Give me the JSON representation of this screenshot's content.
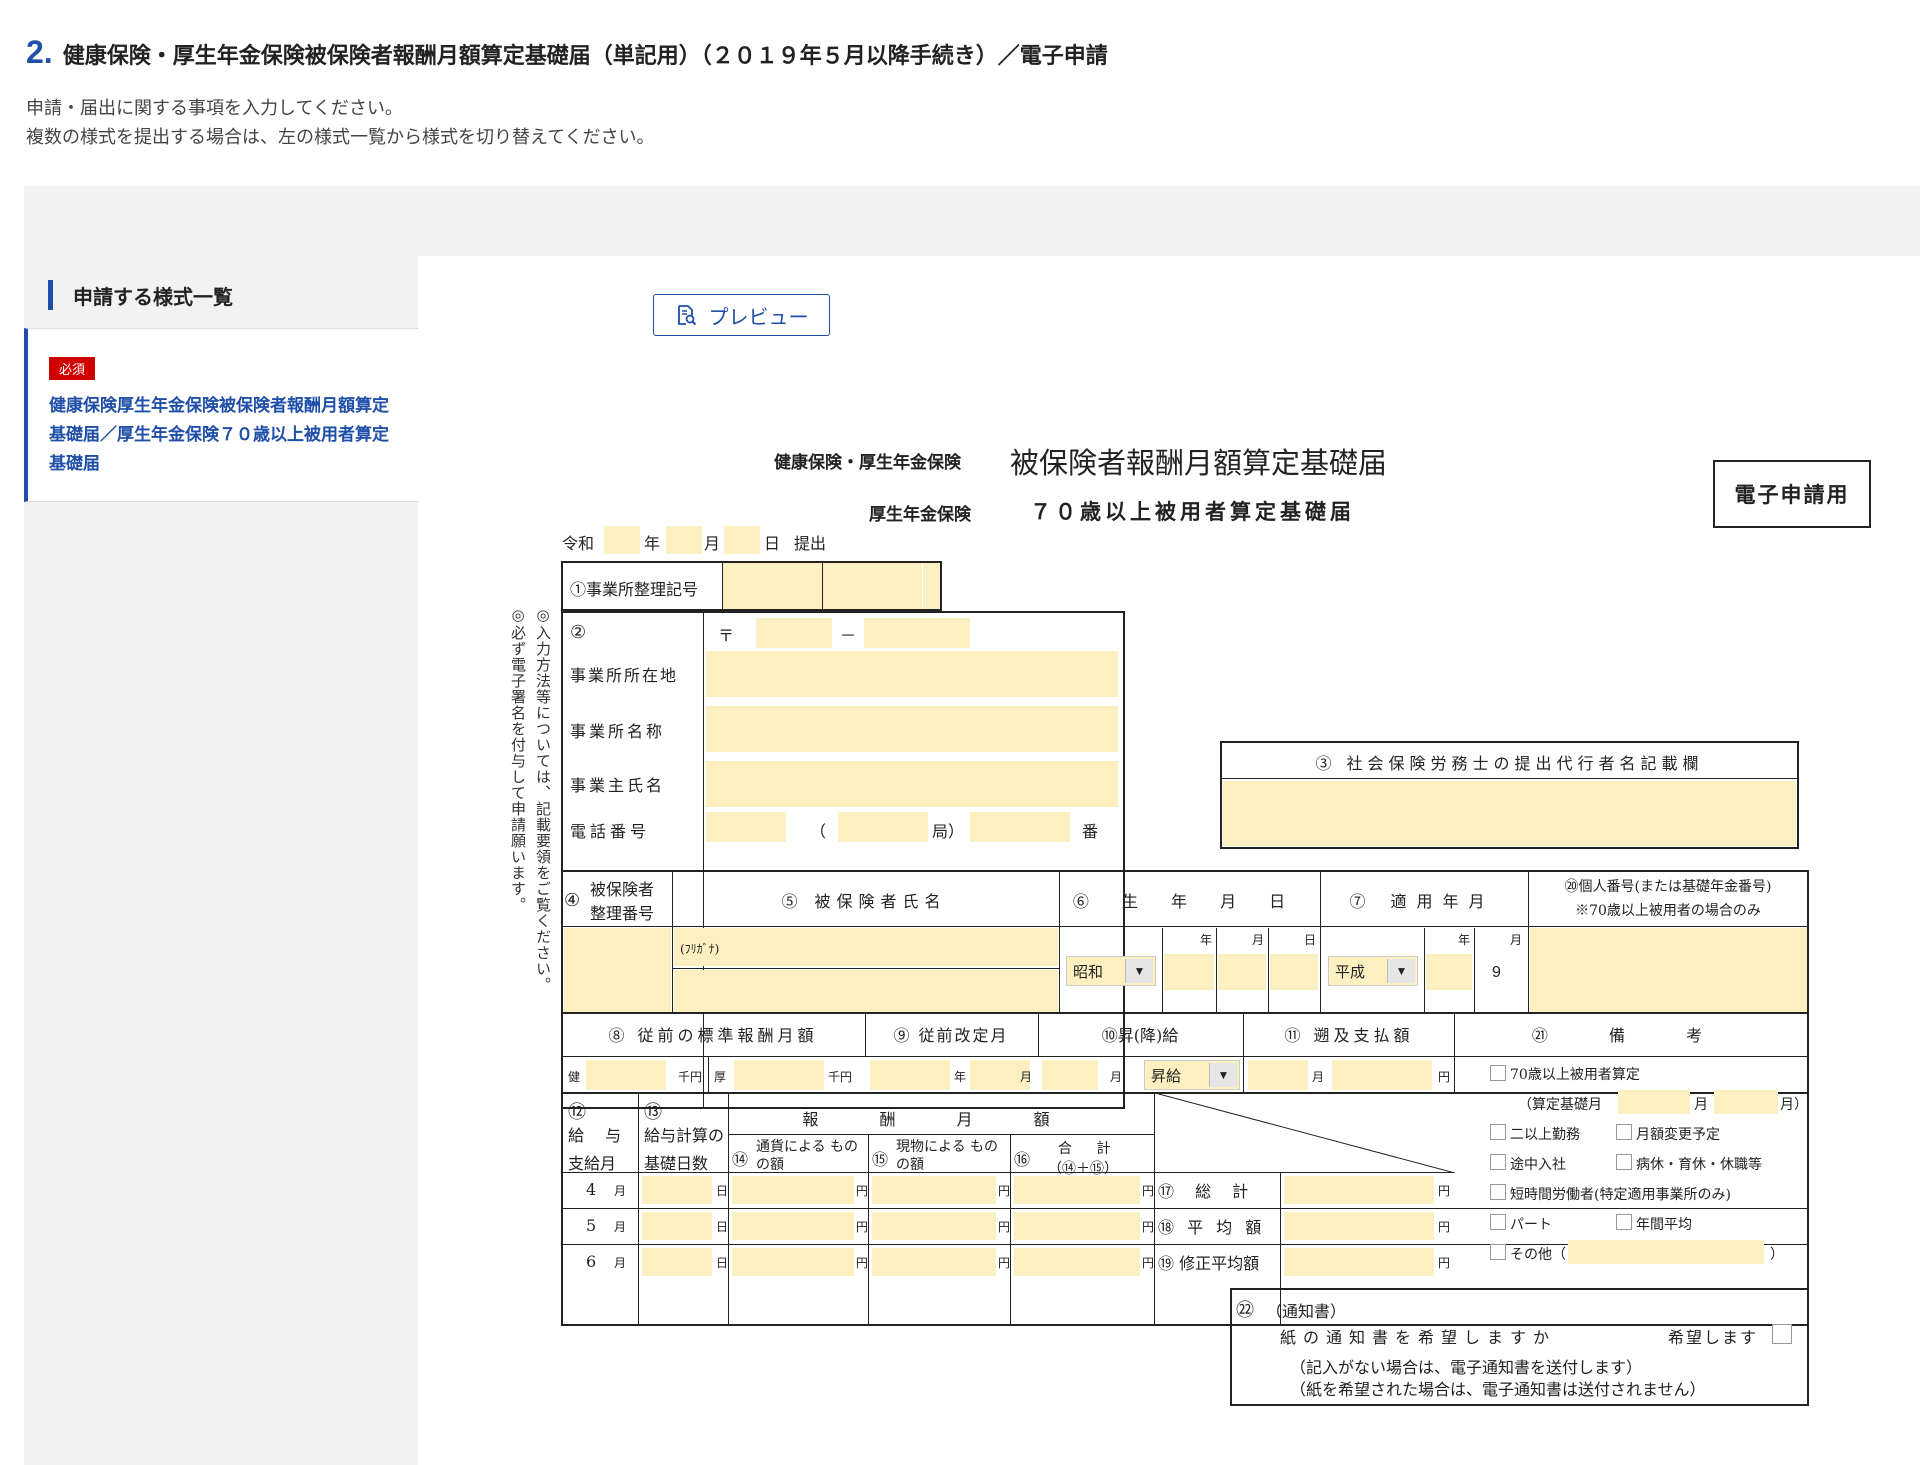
{
  "header": {
    "step_number": "2.",
    "title": "健康保険・厚生年金保険被保険者報酬月額算定基礎届（単記用）（２０１９年５月以降手続き）／電子申請",
    "intro_line1": "申請・届出に関する事項を入力してください。",
    "intro_line2": "複数の様式を提出する場合は、左の様式一覧から様式を切り替えてください。"
  },
  "sidebar": {
    "heading": "申請する様式一覧",
    "items": [
      {
        "badge": "必須",
        "label": "健康保険厚生年金保険被保険者報酬月額算定基礎届／厚生年金保険７０歳以上被用者算定基礎届"
      }
    ]
  },
  "toolbar": {
    "preview_label": "プレビュー"
  },
  "form": {
    "side_note1": "◎入力方法等については、記載要領をご覧ください。",
    "side_note2": "◎必ず電子署名を付与して申請願います。",
    "title_prefix": "健康保険・厚生年金保険",
    "title_main": "被保険者報酬月額算定基礎届",
    "subtitle_prefix": "厚生年金保険",
    "subtitle_main": "７０歳以上被用者算定基礎届",
    "e_filing_label": "電子申請用",
    "date_line": {
      "era": "令和",
      "year": "年",
      "month": "月",
      "day": "日",
      "submit": "提出"
    },
    "office": {
      "code_label": "①事業所整理記号",
      "num2": "②",
      "postal_mark": "〒",
      "dash": "－",
      "address_label": "事業所所在地",
      "name_label": "事業所名称",
      "owner_label": "事業主氏名",
      "phone_label": "電話番号",
      "phone_paren_open": "（",
      "phone_local": "局）",
      "phone_num": "番"
    },
    "agent": {
      "label": "③ 社会保険労務士の提出代行者名記載欄"
    },
    "insured": {
      "h4a": "④",
      "h4b": "被保険者",
      "h4c": "整理番号",
      "h5": "⑤ 被保険者氏名",
      "h6": "⑥ 生 年 月 日",
      "h7": "⑦ 適用年月",
      "h20a": "⑳個人番号(または基礎年金番号)",
      "h20b": "※70歳以上被用者の場合のみ",
      "furigana": "(ﾌﾘｶﾞﾅ)",
      "year": "年",
      "month": "月",
      "day": "日",
      "birth_era": "昭和",
      "apply_era": "平成",
      "apply_month_value": "9"
    },
    "section8": {
      "h8": "⑧ 従前の標準報酬月額",
      "h9": "⑨ 従前改定月",
      "h10": "⑩昇(降)給",
      "h11": "⑪ 遡及支払額",
      "h21": "㉑ 備 考",
      "ken": "健",
      "sen_yen": "千円",
      "kou": "厚",
      "year": "年",
      "month": "月",
      "raise_select": "昇給",
      "yen": "円"
    },
    "remarks": {
      "over70": "70歳以上被用者算定",
      "basis_month": "（算定基礎月",
      "month": "月",
      "month_close": "月）",
      "multi_work": "二以上勤務",
      "monthly_change": "月額変更予定",
      "mid_join": "途中入社",
      "leave": "病休・育休・休職等",
      "short_time": "短時間労働者(特定適用事業所のみ)",
      "part": "パート",
      "annual_avg": "年間平均",
      "other": "その他（",
      "other_close": "）"
    },
    "pay": {
      "h12a": "⑫",
      "h12b": "給 与",
      "h12c": "支給月",
      "h13a": "⑬",
      "h13b": "給与計算の",
      "h13c": "基礎日数",
      "h_pay": "報 酬 月 額",
      "h14": "⑭",
      "h14txt": "通貨による ものの額",
      "h15": "⑮",
      "h15txt": "現物による ものの額",
      "h16": "⑯",
      "h16txt": "合 計",
      "h16sub": "（⑭＋⑮）",
      "rows": [
        {
          "month": "4",
          "unit_m": "月",
          "unit_d": "日",
          "unit_yen": "円"
        },
        {
          "month": "5",
          "unit_m": "月",
          "unit_d": "日",
          "unit_yen": "円"
        },
        {
          "month": "6",
          "unit_m": "月",
          "unit_d": "日",
          "unit_yen": "円"
        }
      ],
      "total": "⑰ 総 計",
      "average": "⑱ 平 均 額",
      "adjusted": "⑲ 修正平均額"
    },
    "notice": {
      "num": "㉒",
      "label": "（通知書）",
      "question": "紙の通知書を希望しますか",
      "wish": "希望します",
      "note1": "（記入がない場合は、電子通知書を送付します）",
      "note2": "（紙を希望された場合は、電子通知書は送付されません）"
    }
  }
}
